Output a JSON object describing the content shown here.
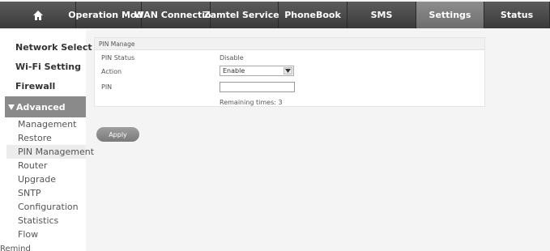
{
  "nav": {
    "home_icon": "home-icon",
    "tabs": [
      {
        "label": "Operation Mode"
      },
      {
        "label": "WAN Connection"
      },
      {
        "label": "Zamtel Services"
      },
      {
        "label": "PhoneBook"
      },
      {
        "label": "SMS"
      },
      {
        "label": "Settings",
        "active": true
      },
      {
        "label": "Status"
      }
    ]
  },
  "sidebar": {
    "main_items": [
      {
        "label": "Network Select"
      },
      {
        "label": "Wi-Fi Setting"
      },
      {
        "label": "Firewall"
      }
    ],
    "advanced": {
      "label": "Advanced",
      "icon": "triangle-down-icon"
    },
    "sub_items": [
      {
        "label": "Management"
      },
      {
        "label": "Restore"
      },
      {
        "label": "PIN Management",
        "selected": true
      },
      {
        "label": "Router"
      },
      {
        "label": "Upgrade"
      },
      {
        "label": "SNTP"
      },
      {
        "label": "Configuration"
      },
      {
        "label": "Statistics"
      },
      {
        "label": "Flow"
      }
    ],
    "remind": "Remind"
  },
  "pin_manage": {
    "title": "PIN Manage",
    "status_label": "PIN Status",
    "status_value": "Disable",
    "action_label": "Action",
    "action_value": "Enable",
    "pin_label": "PIN",
    "pin_value": "",
    "remaining": "Remaining times: 3"
  },
  "apply_label": "Apply",
  "colors": {
    "tab_bg": "#4a4a4a",
    "tab_active_bg": "#7d7d7d",
    "advanced_bg": "#8a8a8a",
    "apply_bg": "#8a8a8a"
  }
}
